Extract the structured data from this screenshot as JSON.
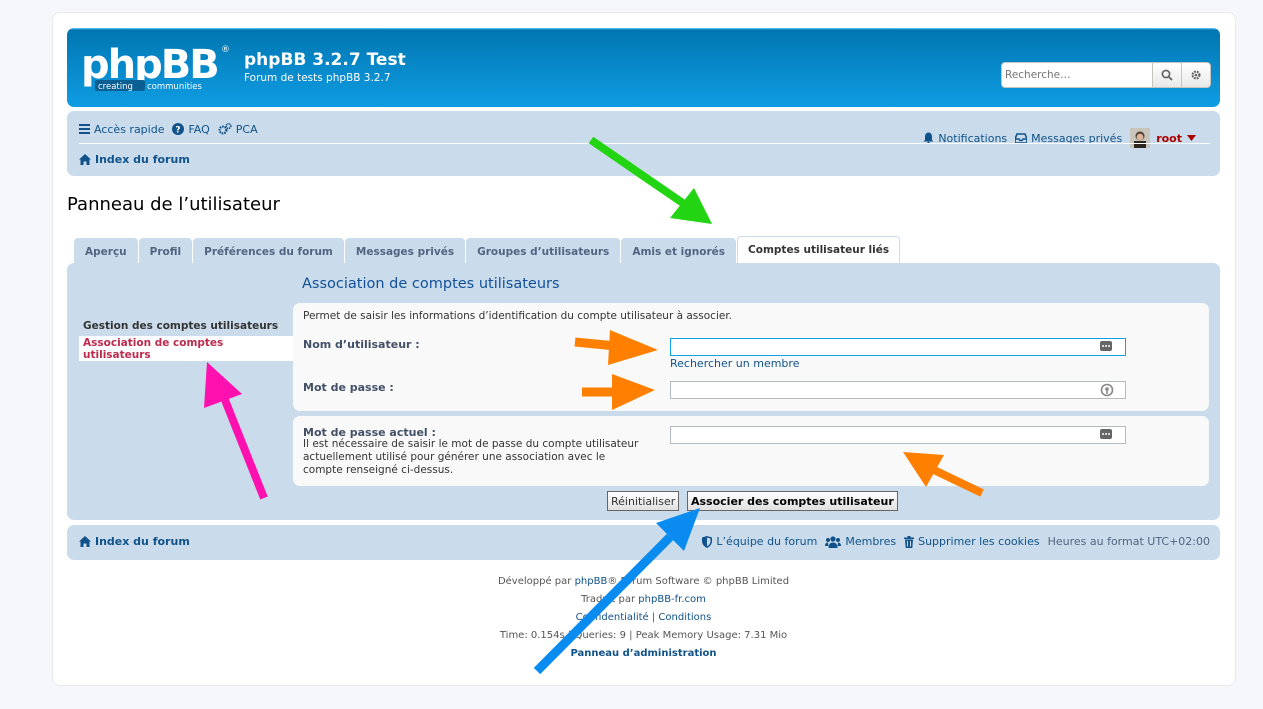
{
  "header": {
    "site_title": "phpBB 3.2.7 Test",
    "site_description": "Forum de tests phpBB 3.2.7",
    "logo_text": "phpBB",
    "logo_tagline_left": "creating",
    "logo_tagline_right": "communities",
    "search_placeholder": "Recherche…",
    "search_icon": "search-icon",
    "advanced_search_icon": "gear-icon"
  },
  "navbar": {
    "quick_links": "Accès rapide",
    "faq": "FAQ",
    "ucp": "PCA",
    "notifications": "Notifications",
    "private_messages": "Messages privés",
    "username": "root",
    "breadcrumb_index": "Index du forum"
  },
  "page": {
    "title": "Panneau de l’utilisateur",
    "tabs": [
      {
        "label": "Aperçu"
      },
      {
        "label": "Profil"
      },
      {
        "label": "Préférences du forum"
      },
      {
        "label": "Messages privés"
      },
      {
        "label": "Groupes d’utilisateurs"
      },
      {
        "label": "Amis et ignorés"
      },
      {
        "label": "Comptes utilisateur liés",
        "active": true
      }
    ]
  },
  "sidebar": {
    "heading": "Gestion des comptes utilisateurs",
    "items": [
      {
        "label": "Association de comptes utilisateurs",
        "active": true
      }
    ]
  },
  "form": {
    "heading": "Association de comptes utilisateurs",
    "intro": "Permet de saisir les informations d’identification du compte utilisateur à associer.",
    "username_label": "Nom d’utilisateur :",
    "username_value": "",
    "find_member": "Rechercher un membre",
    "password_label": "Mot de passe :",
    "password_value": "",
    "current_password_label": "Mot de passe actuel :",
    "current_password_desc_1": "Il est nécessaire de saisir le mot de passe du compte utilisateur",
    "current_password_desc_2": "actuellement utilisé pour générer une association avec le",
    "current_password_desc_3": "compte renseigné ci-dessus.",
    "current_password_value": "",
    "reset_label": "Réinitialiser",
    "submit_label": "Associer des comptes utilisateur"
  },
  "footer": {
    "index": "Index du forum",
    "team": "L’équipe du forum",
    "members": "Membres",
    "delete_cookies": "Supprimer les cookies",
    "timezone": "Heures au format UTC+02:00"
  },
  "copyright": {
    "line1_prefix": "Développé par ",
    "line1_link": "phpBB",
    "line1_suffix": "® Forum Software © phpBB Limited",
    "line2_prefix": "Traduit par ",
    "line2_link": "phpBB-fr.com",
    "line3_privacy": "Confidentialité",
    "line3_sep": " | ",
    "line3_terms": "Conditions",
    "line4": "Time: 0.154s | Queries: 9 | Peak Memory Usage: 7.31 Mio",
    "line5": "Panneau d’administration"
  },
  "colors": {
    "header": "#12a3eb",
    "navbar": "#cadceb",
    "link": "#105289",
    "active_menu": "#bc2a4d",
    "arrow_green": "#22d411",
    "arrow_orange": "#ff8000",
    "arrow_pink": "#ff11b0",
    "arrow_blue": "#0a8bf0"
  }
}
